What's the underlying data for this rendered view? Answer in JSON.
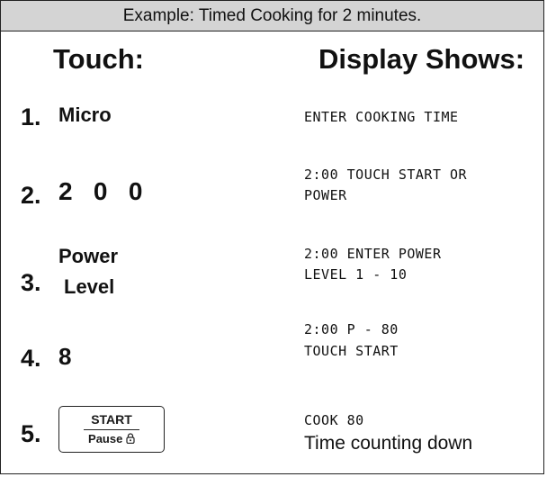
{
  "header": {
    "title": "Example: Timed Cooking for 2 minutes."
  },
  "columns": {
    "touch": "Touch:",
    "display": "Display Shows:"
  },
  "steps": [
    {
      "number": "1.",
      "touch": "Micro",
      "display": [
        "ENTER COOKING TIME"
      ]
    },
    {
      "number": "2.",
      "touch": "2   0   0",
      "display": [
        "2:00 TOUCH START OR",
        "POWER"
      ]
    },
    {
      "number": "3.",
      "touch": [
        "Power",
        "Level"
      ],
      "display": [
        "2:00 ENTER POWER",
        "LEVEL 1 - 10"
      ]
    },
    {
      "number": "4.",
      "touch": "8",
      "display": [
        "2:00 P - 80",
        "TOUCH START"
      ]
    },
    {
      "number": "5.",
      "touch": {
        "start": "START",
        "pause": "Pause",
        "icon": "lock-icon"
      },
      "display": [
        "COOK 80",
        "Time counting down"
      ]
    }
  ]
}
